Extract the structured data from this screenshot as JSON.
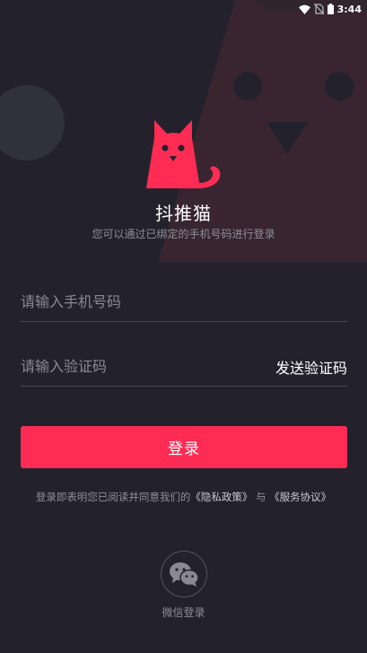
{
  "status_bar": {
    "time": "3:44",
    "icons": [
      "wifi-icon",
      "no-sim-icon",
      "battery-icon"
    ]
  },
  "app": {
    "title": "抖推猫",
    "subtitle": "您可以通过已绑定的手机号码进行登录"
  },
  "form": {
    "phone_placeholder": "请输入手机号码",
    "phone_value": "",
    "code_placeholder": "请输入验证码",
    "code_value": "",
    "send_code_label": "发送验证码",
    "login_label": "登录"
  },
  "agreement": {
    "prefix": "登录即表明您已阅读并同意我们的",
    "privacy_link": "《隐私政策》",
    "conjunction": "与",
    "service_link": "《服务协议》"
  },
  "wechat": {
    "label": "微信登录",
    "icon": "wechat-icon"
  },
  "colors": {
    "background": "#23222c",
    "accent": "#fe2c55",
    "decor": "#3a2a35"
  }
}
